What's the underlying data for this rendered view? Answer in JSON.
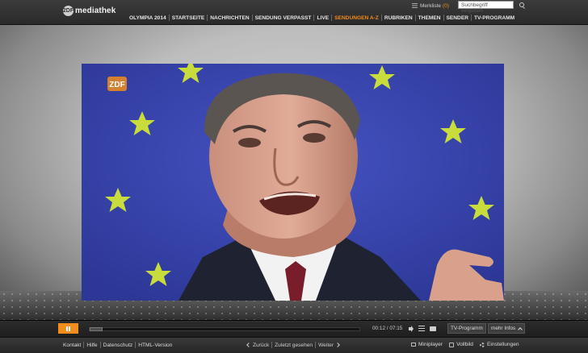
{
  "header": {
    "logo_mark": "2DF",
    "logo_text": "mediathek",
    "merkliste_label": "Merkliste",
    "merkliste_count": "(0)",
    "search_placeholder": "Suchbegriff eingeben",
    "nav": [
      {
        "label": "OLYMPIA 2014"
      },
      {
        "label": "STARTSEITE"
      },
      {
        "label": "NACHRICHTEN"
      },
      {
        "label": "SENDUNG VERPASST"
      },
      {
        "label": "LIVE"
      },
      {
        "label": "SENDUNGEN A-Z",
        "active": true
      },
      {
        "label": "RUBRIKEN"
      },
      {
        "label": "THEMEN"
      },
      {
        "label": "SENDER"
      },
      {
        "label": "TV-PROGRAMM"
      }
    ],
    "accent_color": "#f28c1a"
  },
  "video": {
    "overlay_logo": "ZDF"
  },
  "player": {
    "progress_fraction": 0.028,
    "time": "00:12 / 07:15",
    "tv_programm_label": "TV-Programm",
    "mehr_infos_label": "mehr Infos"
  },
  "footer": {
    "links": [
      "Kontakt",
      "Hilfe",
      "Datenschutz",
      "HTML-Version"
    ],
    "back_label": "Zurück",
    "recent_label": "Zuletzt gesehen",
    "forward_label": "Weiter",
    "miniplayer_label": "Miniplayer",
    "vollbild_label": "Vollbild",
    "einstellungen_label": "Einstellungen"
  }
}
